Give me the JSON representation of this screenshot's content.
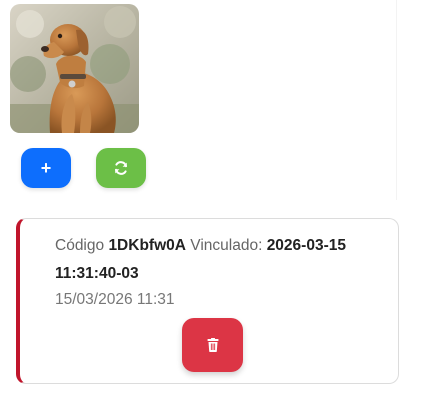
{
  "profile": {
    "photo_icon": "dog-photo"
  },
  "actions": {
    "add_icon": "plus-icon",
    "add_glyph": "+",
    "refresh_icon": "sync-icon",
    "accent_add": "#0d6efd",
    "accent_refresh": "#6cbf47"
  },
  "record": {
    "code_label": "Código",
    "code_value": "1DKbfw0A",
    "linked_label": "Vinculado:",
    "linked_value": "2026-03-15 11:31:40-03",
    "date": "15/03/2026 11:31",
    "delete_icon": "trash-icon",
    "accent_border": "#c0152b",
    "accent_delete": "#dc3545"
  }
}
